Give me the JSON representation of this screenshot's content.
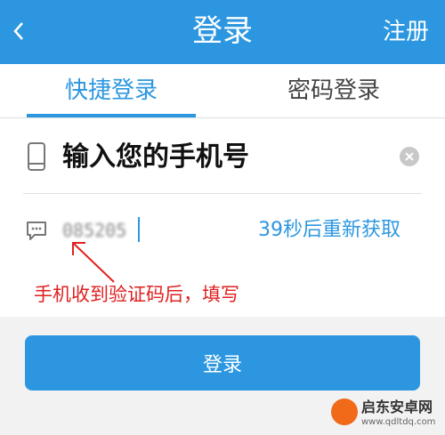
{
  "header": {
    "title": "登录",
    "register_label": "注册"
  },
  "tabs": [
    {
      "label": "快捷登录",
      "active": true
    },
    {
      "label": "密码登录",
      "active": false
    }
  ],
  "phone_field": {
    "placeholder": "输入您的手机号"
  },
  "code_field": {
    "value": "085205"
  },
  "resend_label": "39秒后重新获取",
  "annotation_text": "手机收到验证码后，填写",
  "login_button": {
    "label": "登录"
  },
  "watermark": {
    "name": "启东安卓网",
    "url": "www.qdltdq.com"
  },
  "colors": {
    "primary": "#2c97e0",
    "annotation": "#e02020",
    "background": "#f2f2f2"
  }
}
